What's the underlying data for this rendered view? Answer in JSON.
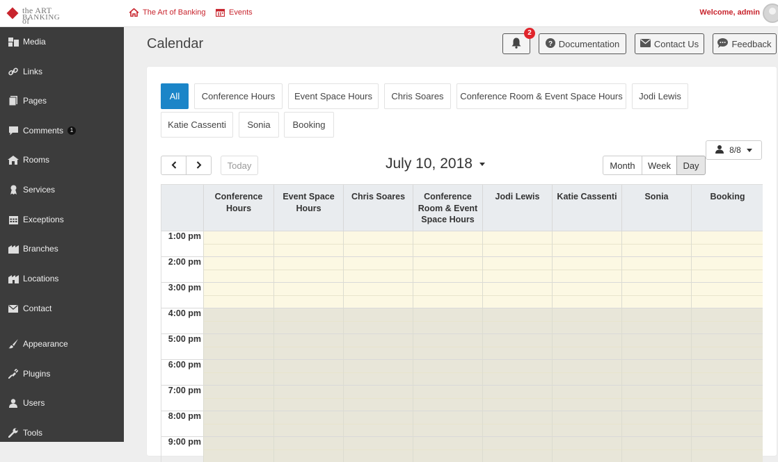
{
  "topbar": {
    "logo_line1": "the ART of",
    "logo_line2": "BANKING",
    "site_link": "The Art of Banking",
    "events_link": "Events",
    "welcome": "Welcome, admin",
    "accent_color": "#c8242d"
  },
  "sidebar": {
    "items": [
      {
        "label": "Media",
        "icon": "media-icon"
      },
      {
        "label": "Links",
        "icon": "link-icon"
      },
      {
        "label": "Pages",
        "icon": "pages-icon"
      },
      {
        "label": "Comments",
        "icon": "comment-icon",
        "badge": "1"
      },
      {
        "label": "Rooms",
        "icon": "rooms-icon"
      },
      {
        "label": "Services",
        "icon": "services-icon"
      },
      {
        "label": "Exceptions",
        "icon": "calendar-icon"
      },
      {
        "label": "Branches",
        "icon": "branches-icon"
      },
      {
        "label": "Locations",
        "icon": "locations-icon"
      },
      {
        "label": "Contact",
        "icon": "envelope-icon"
      },
      {
        "label": "Appearance",
        "icon": "brush-icon"
      },
      {
        "label": "Plugins",
        "icon": "plug-icon"
      },
      {
        "label": "Users",
        "icon": "user-icon"
      },
      {
        "label": "Tools",
        "icon": "wrench-icon"
      }
    ]
  },
  "header": {
    "title": "Calendar",
    "notification_count": "2",
    "documentation": "Documentation",
    "contact": "Contact Us",
    "feedback": "Feedback"
  },
  "filters": [
    "All",
    "Conference Hours",
    "Event Space Hours",
    "Chris Soares",
    "Conference Room & Event Space Hours",
    "Jodi Lewis",
    "Katie Cassenti",
    "Sonia",
    "Booking"
  ],
  "active_filter": "All",
  "toolbar": {
    "resource_count": "8/8",
    "today": "Today",
    "date": "July 10, 2018",
    "views": [
      "Month",
      "Week",
      "Day"
    ],
    "active_view": "Day"
  },
  "calendar": {
    "columns": [
      "Conference Hours",
      "Event Space Hours",
      "Chris Soares",
      "Conference Room & Event Space Hours",
      "Jodi Lewis",
      "Katie Cassenti",
      "Sonia",
      "Booking"
    ],
    "times": [
      "1:00 pm",
      "2:00 pm",
      "3:00 pm",
      "4:00 pm",
      "5:00 pm",
      "6:00 pm",
      "7:00 pm",
      "8:00 pm",
      "9:00 pm"
    ],
    "business_hours_color": "#fcf8e3",
    "off_hours_color": "#e8e6d9",
    "accent_color": "#1b85c8"
  }
}
